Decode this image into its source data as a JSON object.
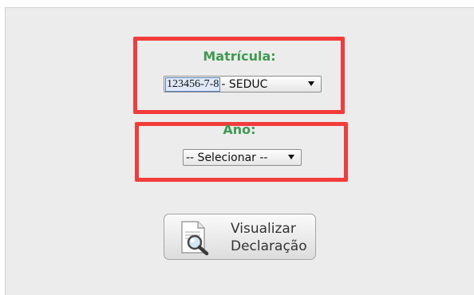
{
  "form": {
    "matricula_label": "Matrícula:",
    "matricula_select": {
      "selected_code": "123456-7-8",
      "selected_suffix": "- SEDUC"
    },
    "ano_label": "Ano:",
    "ano_select": {
      "selected": "-- Selecionar --"
    },
    "view_button": {
      "line1": "Visualizar",
      "line2": "Declaração",
      "icon": "document-magnifier-icon"
    }
  },
  "colors": {
    "label_green": "#3f9a52",
    "highlight_red": "#f23b3b",
    "panel_bg": "#ececec"
  }
}
